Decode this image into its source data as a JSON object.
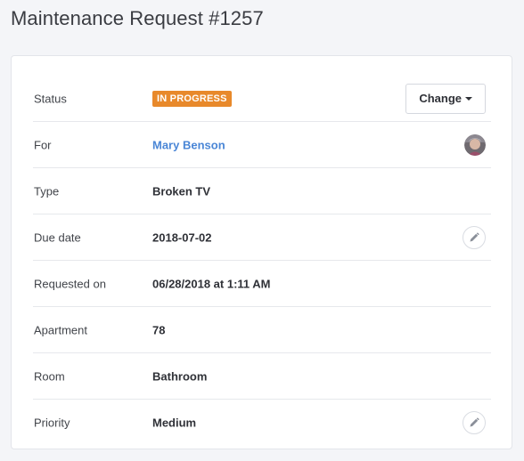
{
  "page": {
    "title": "Maintenance Request #1257"
  },
  "details": {
    "status": {
      "label": "Status",
      "value": "IN PROGRESS",
      "badge_color": "#e8892b",
      "change_label": "Change"
    },
    "for": {
      "label": "For",
      "value": "Mary Benson",
      "link_color": "#4a86d6"
    },
    "type": {
      "label": "Type",
      "value": "Broken TV"
    },
    "due_date": {
      "label": "Due date",
      "value": "2018-07-02"
    },
    "requested_on": {
      "label": "Requested on",
      "value": "06/28/2018 at 1:11 AM"
    },
    "apartment": {
      "label": "Apartment",
      "value": "78"
    },
    "room": {
      "label": "Room",
      "value": "Bathroom"
    },
    "priority": {
      "label": "Priority",
      "value": "Medium"
    }
  },
  "icons": {
    "edit": "pencil-icon",
    "caret": "caret-down-icon",
    "avatar": "user-avatar"
  }
}
